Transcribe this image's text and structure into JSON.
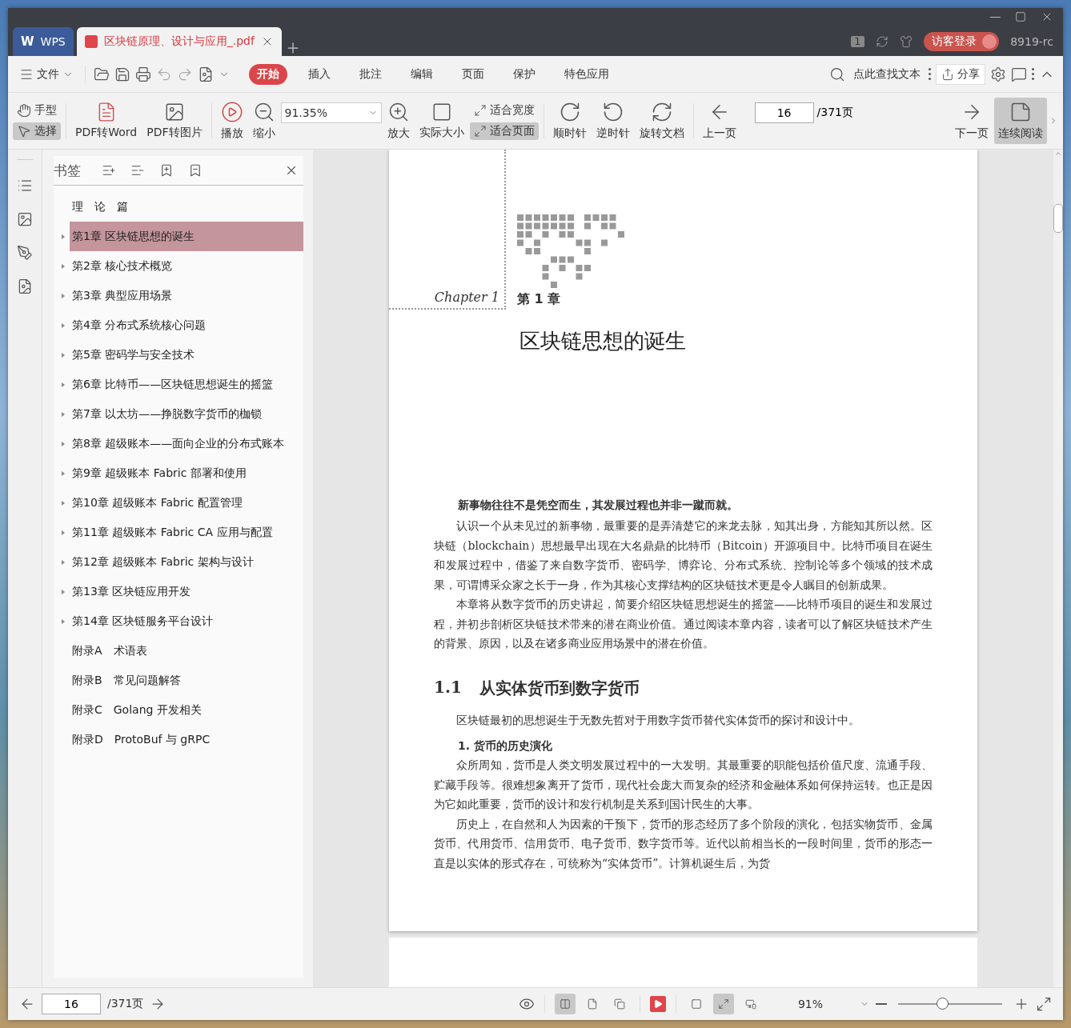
{
  "tabs": [
    {
      "label": "WPS",
      "logo": "W",
      "kind": "home",
      "selected": false
    },
    {
      "label": "区块链原理、设计与应用_.pdf",
      "kind": "document",
      "selected": true
    }
  ],
  "account": {
    "badge": "1",
    "login": "访客登录",
    "user": "8919-rc"
  },
  "menu": {
    "file": "文件",
    "items": [
      {
        "label": "开始",
        "selected": true
      },
      {
        "label": "插入",
        "selected": false
      },
      {
        "label": "批注",
        "selected": false
      },
      {
        "label": "编辑",
        "selected": false
      },
      {
        "label": "页面",
        "selected": false
      },
      {
        "label": "保护",
        "selected": false
      },
      {
        "label": "特色应用",
        "selected": false
      }
    ],
    "search": "点此查找文本",
    "share": "分享"
  },
  "toolbar": {
    "tools": [
      {
        "label": "手型",
        "selected": false
      },
      {
        "label": "选择",
        "selected": true
      }
    ],
    "pdf_to_word": "PDF转Word",
    "pdf_to_image": "PDF转图片",
    "play": "播放",
    "zoom_out": "缩小",
    "zoom": "91.35%",
    "zoom_in": "放大",
    "actual_size": "实际大小",
    "fit": [
      {
        "label": "适合宽度",
        "selected": false
      },
      {
        "label": "适合页面",
        "selected": true
      }
    ],
    "clockwise": "顺时针",
    "counterclockwise": "逆时针",
    "rotate_document": "旋转文档",
    "prev_page": "上一页",
    "page": "16",
    "total": "/371页",
    "next_page": "下一页",
    "continuous": {
      "label": "连续阅读",
      "selected": true
    }
  },
  "bookmarks": {
    "title": "书签",
    "items": [
      {
        "label": "理　论　篇",
        "expandable": false,
        "selected": false
      },
      {
        "label": "第1章 区块链思想的诞生",
        "expandable": true,
        "selected": true
      },
      {
        "label": "第2章 核心技术概览",
        "expandable": true,
        "selected": false
      },
      {
        "label": "第3章 典型应用场景",
        "expandable": true,
        "selected": false
      },
      {
        "label": "第4章 分布式系统核心问题",
        "expandable": true,
        "selected": false
      },
      {
        "label": "第5章 密码学与安全技术",
        "expandable": true,
        "selected": false
      },
      {
        "label": "第6章 比特币——区块链思想诞生的摇篮",
        "expandable": true,
        "selected": false
      },
      {
        "label": "第7章 以太坊——挣脱数字货币的枷锁",
        "expandable": true,
        "selected": false
      },
      {
        "label": "第8章 超级账本——面向企业的分布式账本",
        "expandable": true,
        "selected": false
      },
      {
        "label": "第9章 超级账本 Fabric 部署和使用",
        "expandable": true,
        "selected": false
      },
      {
        "label": "第10章 超级账本 Fabric 配置管理",
        "expandable": true,
        "selected": false
      },
      {
        "label": "第11章 超级账本 Fabric CA 应用与配置",
        "expandable": true,
        "selected": false
      },
      {
        "label": "第12章 超级账本 Fabric 架构与设计",
        "expandable": true,
        "selected": false
      },
      {
        "label": "第13章 区块链应用开发",
        "expandable": true,
        "selected": false
      },
      {
        "label": "第14章 区块链服务平台设计",
        "expandable": true,
        "selected": false
      },
      {
        "label": "附录A　术语表",
        "expandable": false,
        "selected": false
      },
      {
        "label": "附录B　常见问题解答",
        "expandable": false,
        "selected": false
      },
      {
        "label": "附录C　Golang 开发相关",
        "expandable": false,
        "selected": false
      },
      {
        "label": "附录D　ProtoBuf 与 gRPC",
        "expandable": false,
        "selected": false
      }
    ]
  },
  "document": {
    "chapter_script": "Chapter 1",
    "chapter_number": "第 1 章",
    "chapter_title": "区块链思想的诞生",
    "lead": "新事物往往不是凭空而生，其发展过程也并非一蹴而就。",
    "intro": [
      "认识一个从未见过的新事物，最重要的是弄清楚它的来龙去脉，知其出身，方能知其所以然。区块链（blockchain）思想最早出现在大名鼎鼎的比特币（Bitcoin）开源项目中。比特币项目在诞生和发展过程中，借鉴了来自数字货币、密码学、博弈论、分布式系统、控制论等多个领域的技术成果，可谓博采众家之长于一身，作为其核心支撑结构的区块链技术更是令人瞩目的创新成果。",
      "本章将从数字货币的历史讲起，简要介绍区块链思想诞生的摇篮——比特币项目的诞生和发展过程，并初步剖析区块链技术带来的潜在商业价值。通过阅读本章内容，读者可以了解区块链技术产生的背景、原因，以及在诸多商业应用场景中的潜在价值。"
    ],
    "section_number": "1.1",
    "section_title": "从实体货币到数字货币",
    "section_intro": "区块链最初的思想诞生于无数先哲对于用数字货币替代实体货币的探讨和设计中。",
    "subsection": "1. 货币的历史演化",
    "body": [
      "众所周知，货币是人类文明发展过程中的一大发明。其最重要的职能包括价值尺度、流通手段、贮藏手段等。很难想象离开了货币，现代社会庞大而复杂的经济和金融体系如何保持运转。也正是因为它如此重要，货币的设计和发行机制是关系到国计民生的大事。",
      "历史上，在自然和人为因素的干预下，货币的形态经历了多个阶段的演化，包括实物货币、金属货币、代用货币、信用货币、电子货币、数字货币等。近代以前相当长的一段时间里，货币的形态一直是以实体的形式存在，可统称为“实体货币”。计算机诞生后，为货"
    ]
  },
  "status_bar": {
    "page": "16",
    "total": "/371页",
    "views": [
      {
        "selected": true
      },
      {
        "selected": false
      },
      {
        "selected": false
      }
    ],
    "fits": [
      {
        "selected": false
      },
      {
        "selected": true
      },
      {
        "selected": false
      }
    ],
    "zoom": "91%",
    "level": 0.43
  }
}
